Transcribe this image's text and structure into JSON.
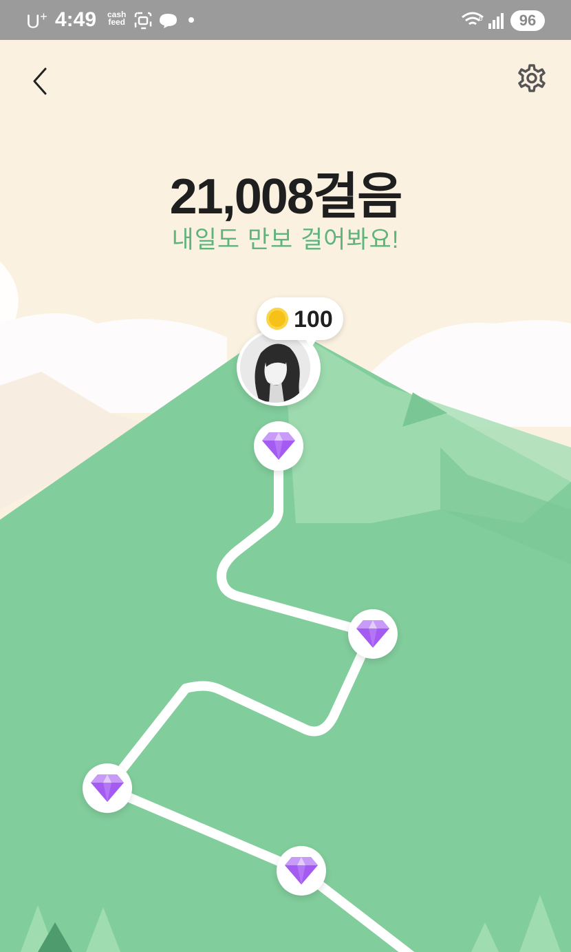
{
  "status_bar": {
    "carrier": "U",
    "carrier_sup": "+",
    "time": "4:49",
    "cashfeed_line1": "cash",
    "cashfeed_line2": "feed",
    "battery": "96"
  },
  "header": {
    "back_icon": "chevron-left-icon",
    "settings_icon": "gear-icon"
  },
  "steps": {
    "count": "21,008걸음",
    "message": "내일도 만보 걸어봐요!"
  },
  "reward": {
    "coin_icon": "coin-icon",
    "amount": "100"
  },
  "path_nodes": [
    {
      "icon": "diamond-icon"
    },
    {
      "icon": "diamond-icon"
    },
    {
      "icon": "diamond-icon"
    },
    {
      "icon": "diamond-icon"
    }
  ],
  "colors": {
    "background": "#FBF1E1",
    "mountain": "#82CD9C",
    "accent_text": "#5FB47C",
    "gem": "#A45BF2"
  }
}
